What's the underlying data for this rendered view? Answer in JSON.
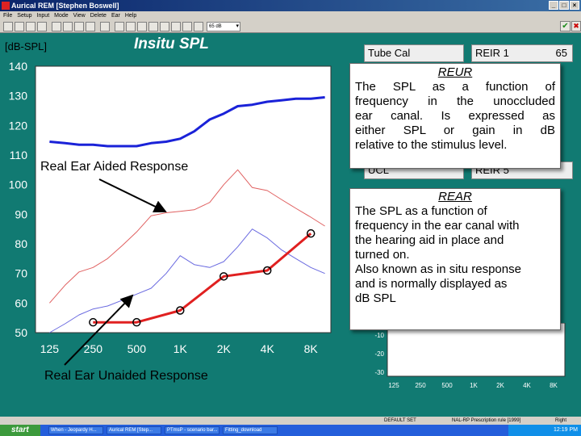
{
  "window": {
    "title": "Aurical REM [Stephen Boswell]",
    "controls": [
      "_",
      "□",
      "×"
    ]
  },
  "menu": [
    "File",
    "Setup",
    "Input",
    "Mode",
    "View",
    "Delete",
    "Ear",
    "Help"
  ],
  "toolbar": {
    "level_value": "65 dB",
    "confirm_icon": "check-icon",
    "cancel_icon": "x-icon"
  },
  "chart_header": {
    "units": "[dB-SPL]",
    "title": "Insitu SPL"
  },
  "chart_data": {
    "type": "line",
    "title": "Insitu SPL",
    "ylabel": "[dB-SPL]",
    "xlabel": "",
    "x_ticks": [
      "125",
      "250",
      "500",
      "1K",
      "2K",
      "4K",
      "8K"
    ],
    "y_ticks": [
      140,
      130,
      120,
      110,
      100,
      90,
      80,
      70,
      60,
      50
    ],
    "ylim": [
      50,
      140
    ],
    "x_scale": "log",
    "grid": false,
    "series": [
      {
        "color": "#1a22d8",
        "x": [
          125,
          160,
          200,
          250,
          315,
          400,
          500,
          630,
          800,
          1000,
          1250,
          1600,
          2000,
          2500,
          3150,
          4000,
          5000,
          6300,
          8000,
          10000
        ],
        "values": [
          114.5,
          114,
          113.5,
          113.5,
          113,
          113,
          113,
          114,
          114.5,
          115.5,
          118,
          122,
          124,
          126.5,
          127,
          128,
          128.5,
          129,
          129,
          129.5
        ]
      },
      {
        "color": "#e02020",
        "x": [
          250,
          500,
          1000,
          2000,
          4000,
          8000
        ],
        "values": [
          53.5,
          53.5,
          57.5,
          69,
          71,
          83.5
        ]
      },
      {
        "color": "#e06060",
        "x": [
          125,
          160,
          200,
          250,
          315,
          400,
          500,
          630,
          800,
          1000,
          1250,
          1600,
          2000,
          2500,
          3150,
          4000,
          5000,
          6300,
          8000,
          10000
        ],
        "values": [
          60,
          66,
          70.5,
          72,
          75,
          79.5,
          84,
          89.5,
          90.5,
          91,
          91.5,
          94,
          100,
          105,
          99,
          98,
          95,
          92,
          89,
          86
        ]
      },
      {
        "color": "#6a6ae0",
        "x": [
          125,
          160,
          200,
          250,
          315,
          400,
          500,
          630,
          800,
          1000,
          1250,
          1600,
          2000,
          2500,
          3150,
          4000,
          5000,
          6300,
          8000,
          10000
        ],
        "values": [
          50,
          53,
          56,
          58,
          59,
          61,
          63,
          65,
          70,
          76,
          73,
          72,
          74,
          79,
          85,
          82,
          78,
          75,
          72,
          70
        ]
      }
    ],
    "annotations": [
      "Real Ear Aided Response",
      "Real Ear Unaided Response"
    ]
  },
  "fields": [
    {
      "label": "Tube Cal",
      "value": ""
    },
    {
      "label": "REIR 1",
      "value": "65"
    },
    {
      "label": "UCL",
      "value": ""
    },
    {
      "label": "REIR 5",
      "value": ""
    }
  ],
  "side_graph": {
    "y_ticks": [
      "-10",
      "-20",
      "-30"
    ],
    "x_ticks": [
      "125",
      "250",
      "500",
      "1K",
      "2K",
      "4K",
      "8K"
    ]
  },
  "callouts": {
    "reur": {
      "heading": "REUR",
      "lines": [
        "The SPL as a function of",
        "frequency in the unoccluded",
        "ear canal. Is expressed as",
        "either SPL or gain in dB",
        "relative to the stimulus level."
      ]
    },
    "rear": {
      "heading": "REAR",
      "lines": [
        "The SPL as a function of",
        "frequency in the ear canal with",
        "the hearing aid in place and",
        "turned on.",
        "Also known as in situ response",
        "and is normally displayed as",
        "dB SPL"
      ]
    }
  },
  "annotation_labels": {
    "aided": "Real Ear Aided Response",
    "unaided": "Real Ear Unaided Response"
  },
  "statusbar": {
    "left": "DEFAULT SET",
    "middle": "NAL-RP Prescription rule [1999]",
    "right": "Right"
  },
  "taskbar": {
    "start": "start",
    "tasks": [
      "When - Jeopardy H...",
      "Aurical REM [Step...",
      "PTmsP - scenario bar...",
      "Fitting_download"
    ],
    "clock": "12:19 PM"
  },
  "colors": {
    "desktop": "#117a72",
    "plot_bg": "#ffffff",
    "aided": "#e02020",
    "reur": "#1a22d8"
  }
}
